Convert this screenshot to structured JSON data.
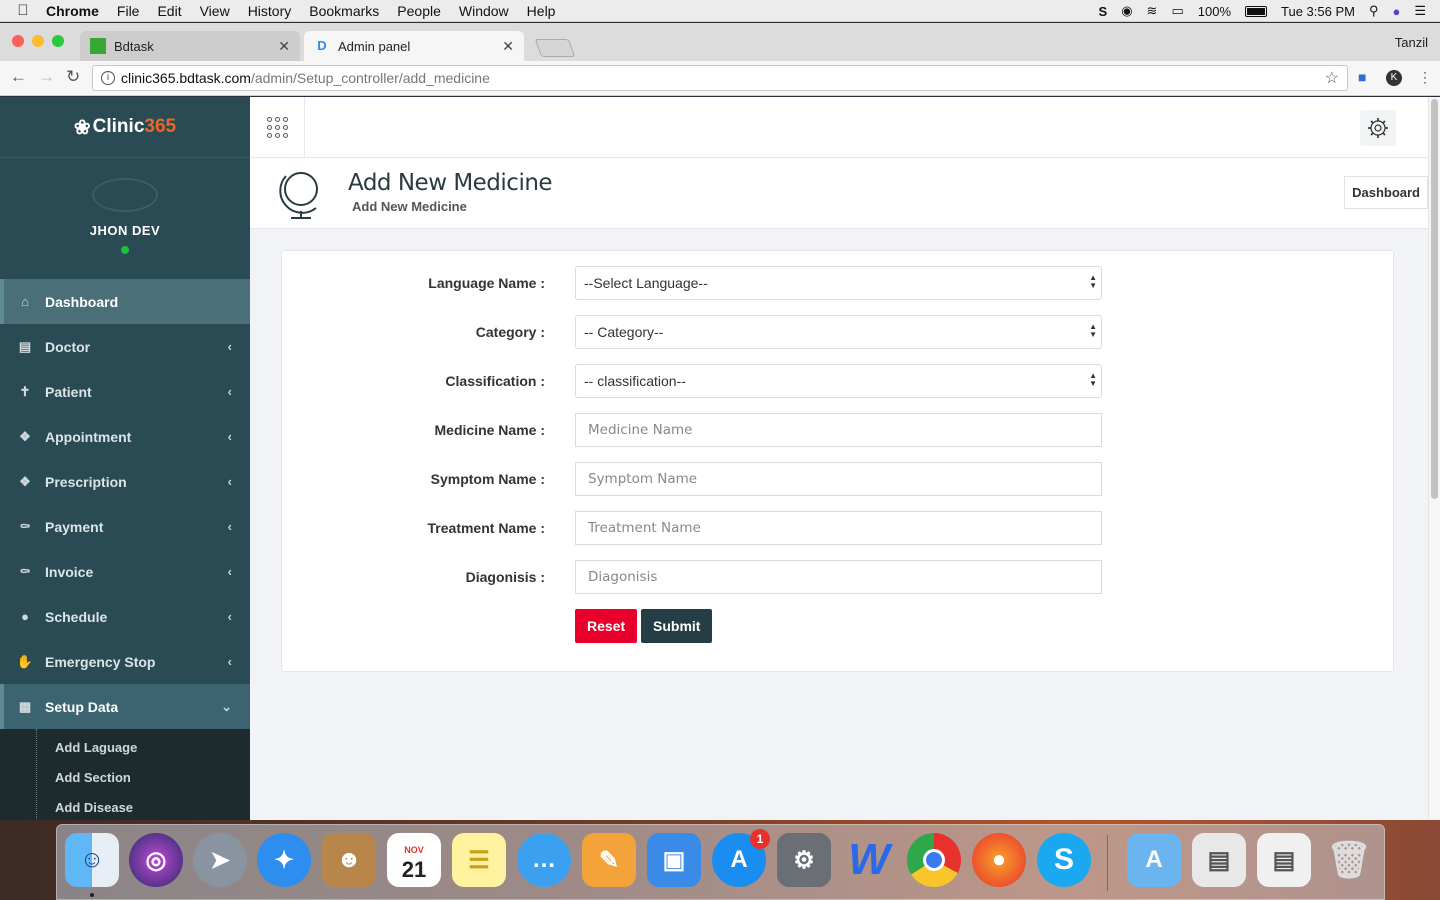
{
  "menubar": {
    "app": "Chrome",
    "menus": [
      "File",
      "Edit",
      "View",
      "History",
      "Bookmarks",
      "People",
      "Window",
      "Help"
    ],
    "battery": "100%",
    "clock": "Tue 3:56 PM"
  },
  "browser": {
    "tabs": [
      {
        "title": "Bdtask",
        "active": false
      },
      {
        "title": "Admin panel",
        "active": true
      }
    ],
    "profile": "Tanzil",
    "url_host": "clinic365.bdtask.com",
    "url_path": "/admin/Setup_controller/add_medicine"
  },
  "sidebar": {
    "brand_name": "Clinic",
    "brand_number": "365",
    "user_name": "JHON DEV",
    "items": [
      {
        "label": "Dashboard",
        "icon": "home-icon"
      },
      {
        "label": "Doctor",
        "icon": "document-icon"
      },
      {
        "label": "Patient",
        "icon": "person-icon"
      },
      {
        "label": "Appointment",
        "icon": "cube-icon"
      },
      {
        "label": "Prescription",
        "icon": "cube-icon"
      },
      {
        "label": "Payment",
        "icon": "tag-icon"
      },
      {
        "label": "Invoice",
        "icon": "tag-icon"
      },
      {
        "label": "Schedule",
        "icon": "chat-icon"
      },
      {
        "label": "Emergency Stop",
        "icon": "hand-icon"
      },
      {
        "label": "Setup Data",
        "icon": "bar-chart-icon"
      }
    ],
    "submenu": [
      "Add Laguage",
      "Add Section",
      "Add Disease"
    ]
  },
  "header": {
    "title": "Add New Medicine",
    "subtitle": "Add New Medicine",
    "breadcrumb": "Dashboard"
  },
  "form": {
    "language_label": "Language Name :",
    "language_value": "--Select Language--",
    "category_label": "Category :",
    "category_value": "-- Category--",
    "classification_label": "Classification :",
    "classification_value": "-- classification--",
    "medicine_label": "Medicine Name :",
    "medicine_placeholder": "Medicine Name",
    "symptom_label": "Symptom Name :",
    "symptom_placeholder": "Symptom Name",
    "treatment_label": "Treatment Name :",
    "treatment_placeholder": "Treatment Name",
    "diagnosis_label": "Diagonisis :",
    "diagnosis_placeholder": "Diagonisis",
    "reset_label": "Reset",
    "submit_label": "Submit"
  },
  "dock": {
    "calendar_month": "NOV",
    "calendar_day": "21",
    "app_store_badge": "1"
  },
  "colors": {
    "sidebar": "#2a4a54",
    "brand_accent": "#e8672a",
    "reset": "#e8002a",
    "submit": "#253e45"
  }
}
